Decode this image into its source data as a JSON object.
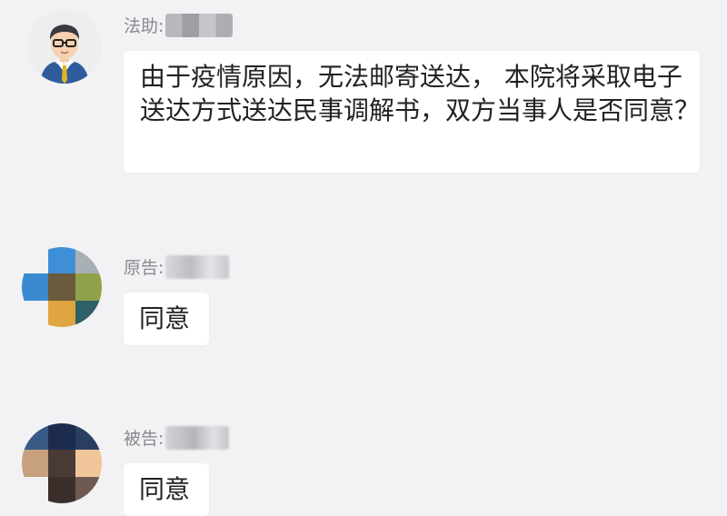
{
  "messages": [
    {
      "sender_label": "法助:",
      "text": "由于疫情原因，无法邮寄送达， 本院将采取电子送达方式送达民事调解书，双方当事人是否同意？",
      "avatar_icon": "assistant-avatar-icon"
    },
    {
      "sender_label": "原告:",
      "text": "同意",
      "avatar_icon": "pixelated-avatar",
      "avatar_colors": [
        "#f2f2f4",
        "#3f8fd6",
        "#a8b0b6",
        "#3b8ad0",
        "#6c5a3c",
        "#8fa24a",
        "#f2f2f4",
        "#e0a540",
        "#2f5f68"
      ]
    },
    {
      "sender_label": "被告:",
      "text": "同意",
      "avatar_icon": "pixelated-avatar",
      "avatar_colors": [
        "#3a5a86",
        "#1d2c4e",
        "#2a3d63",
        "#c7a07e",
        "#4a3a36",
        "#f1c59a",
        "#f2f2f4",
        "#3b2e2b",
        "#6f5a52"
      ]
    }
  ]
}
